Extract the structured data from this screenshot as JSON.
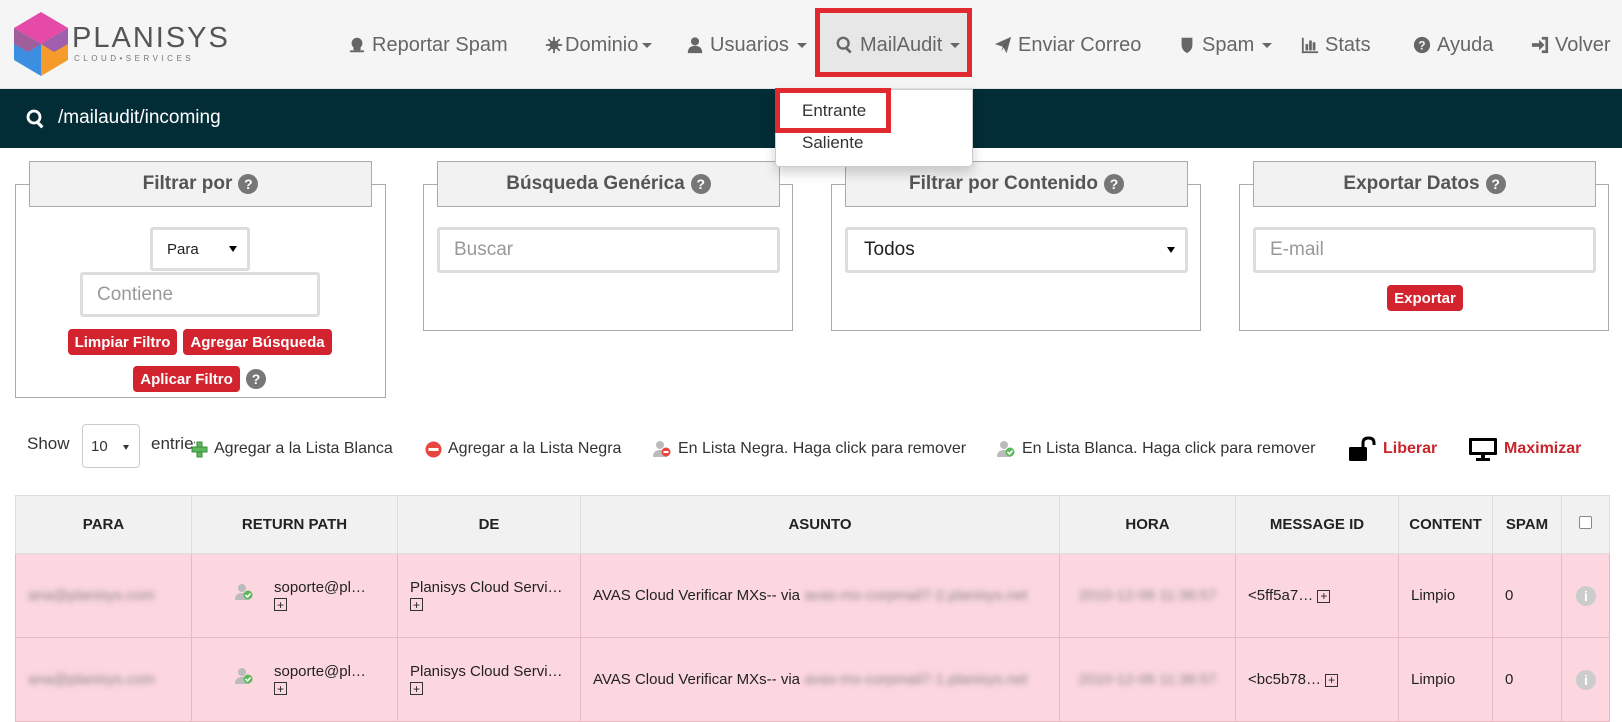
{
  "brand": {
    "name": "PLANISYS",
    "tagline": "CLOUD•SERVICES"
  },
  "nav": {
    "report_spam": "Reportar Spam",
    "dominio": "Dominio",
    "usuarios": "Usuarios",
    "mailaudit": "MailAudit",
    "enviar_correo": "Enviar Correo",
    "spam": "Spam",
    "stats": "Stats",
    "ayuda": "Ayuda",
    "volver": "Volver"
  },
  "path": "/mailaudit/incoming",
  "mailaudit_menu": {
    "items": [
      "Entrante",
      "Saliente"
    ],
    "selected": "Entrante"
  },
  "filters": {
    "filtrar_por": {
      "title": "Filtrar por",
      "select_value": "Para",
      "placeholder": "Contiene",
      "btn_limpiar": "Limpiar Filtro",
      "btn_agregar": "Agregar Búsqueda",
      "btn_aplicar": "Aplicar Filtro"
    },
    "busqueda": {
      "title": "Búsqueda Genérica",
      "placeholder": "Buscar"
    },
    "contenido": {
      "title": "Filtrar por Contenido",
      "select_value": "Todos"
    },
    "exportar": {
      "title": "Exportar Datos",
      "placeholder": "E-mail",
      "btn": "Exportar"
    }
  },
  "toolbar": {
    "show": "Show",
    "entries_value": "10",
    "entries": "entries",
    "add_white": "Agregar a la Lista Blanca",
    "add_black": "Agregar a la Lista Negra",
    "in_black": "En Lista Negra. Haga click para remover",
    "in_white": "En Lista Blanca. Haga click para remover",
    "liberar": "Liberar",
    "maximizar": "Maximizar"
  },
  "table": {
    "headers": [
      "PARA",
      "RETURN PATH",
      "DE",
      "ASUNTO",
      "HORA",
      "MESSAGE ID",
      "CONTENT",
      "SPAM"
    ],
    "rows": [
      {
        "para": "ana@planisys.com",
        "return_path": "soporte@pl…",
        "de": "Planisys Cloud Servi…",
        "asunto": "AVAS Cloud Verificar MXs-- via",
        "asunto_blur": "avas-mx-corpmail7-2.planisys.net",
        "hora": "2010-12-06 11:36:57",
        "message_id": "<5ff5a7…",
        "content": "Limpio",
        "spam": "0"
      },
      {
        "para": "ana@planisys.com",
        "return_path": "soporte@pl…",
        "de": "Planisys Cloud Servi…",
        "asunto": "AVAS Cloud Verificar MXs-- via",
        "asunto_blur": "avas-mx-corpmail7-1.planisys.net",
        "hora": "2010-12-06 11:36:57",
        "message_id": "<bc5b78…",
        "content": "Limpio",
        "spam": "0"
      }
    ]
  },
  "colors": {
    "accent_red": "#d2232e",
    "path_bar": "#032d36",
    "row_pink": "#fdd7df",
    "highlight": "#e02a2f"
  }
}
